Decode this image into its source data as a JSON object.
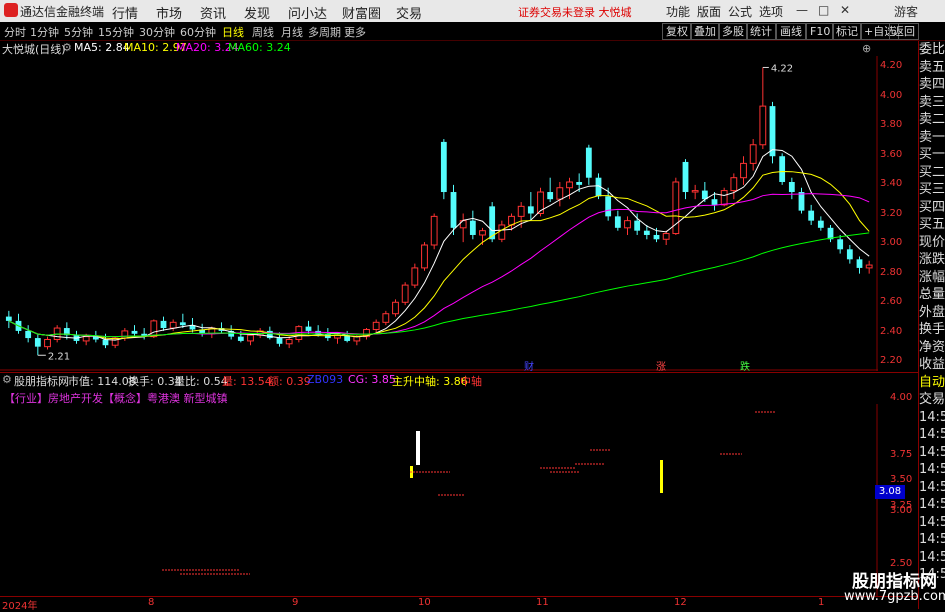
{
  "app": {
    "title": "通达信金融终端",
    "notice": "证券交易未登录 大悦城"
  },
  "menu": [
    "行情",
    "市场",
    "资讯",
    "发现",
    "问小达",
    "财富圈",
    "交易"
  ],
  "right_menu": [
    "功能",
    "版面",
    "公式",
    "选项"
  ],
  "window_buttons": {
    "guest": "游客",
    "min": "—",
    "max": "□",
    "close": "✕"
  },
  "periods": [
    "分时",
    "1分钟",
    "5分钟",
    "15分钟",
    "30分钟",
    "60分钟",
    "日线",
    "周线",
    "月线",
    "多周期",
    "更多"
  ],
  "toolbar_right": [
    "复权",
    "叠加",
    "多股",
    "统计",
    "画线",
    "F10",
    "标记",
    "+自选",
    "返回"
  ],
  "info": {
    "stock": "大悦城(日线)",
    "ma5": "MA5: 2.84",
    "ma10": "MA10: 2.97",
    "ma20": "MA20: 3.24",
    "ma60": "MA60: 3.24",
    "high_label": "4.22",
    "low_label": "2.21"
  },
  "price_axis": [
    "4.20",
    "4.00",
    "3.80",
    "3.60",
    "3.40",
    "3.20",
    "3.00",
    "2.80",
    "2.60",
    "2.40",
    "2.20"
  ],
  "events": [
    "财",
    "涨",
    "跌"
  ],
  "indicator": {
    "name": "股朋指标网",
    "market_cap": "市值: 114.08",
    "turnover": "换手: 0.34",
    "vol_ratio": "量比: 0.54",
    "vol": "量: 13.54",
    "pct": "额: 0.39",
    "zb": "ZB093",
    "cg": "CG: 3.85",
    "axis": "主升中轴: 3.86",
    "mid": "中轴"
  },
  "tags": "【行业】房地产开发【概念】粤港澳 新型城镇",
  "low_axis": [
    "4.00",
    "3.75",
    "3.50",
    "3.25",
    "3.00",
    "2.50"
  ],
  "low_axis_value": "3.08",
  "date_axis": [
    "2024年",
    "8",
    "9",
    "10",
    "11",
    "12",
    "1"
  ],
  "side_panel": [
    "委比",
    "卖五",
    "卖四",
    "卖三",
    "卖二",
    "卖一",
    "买一",
    "买二",
    "买三",
    "买四",
    "买五",
    "现价",
    "涨跌",
    "涨幅",
    "总量",
    "外盘",
    "换手",
    "净资",
    "收益",
    "自动",
    "交易",
    "14:56",
    "14:56",
    "14:56",
    "14:56",
    "14:56",
    "14:56",
    "14:56",
    "14:56",
    "14:56",
    "14:56"
  ],
  "watermark": {
    "line1": "股朋指标网",
    "line2": "www.7gpzb.com"
  },
  "colors": {
    "up": "#ff3333",
    "down": "#54fcfc",
    "ma5": "#ffffff",
    "ma10": "#ffff00",
    "ma20": "#ff00ff",
    "ma60": "#00ff00"
  },
  "chart_data": {
    "type": "candlestick",
    "ylim": [
      2.1,
      4.3
    ],
    "ohlc": [
      [
        2.48,
        2.52,
        2.4,
        2.45
      ],
      [
        2.45,
        2.5,
        2.36,
        2.38
      ],
      [
        2.38,
        2.42,
        2.3,
        2.33
      ],
      [
        2.33,
        2.36,
        2.21,
        2.27
      ],
      [
        2.27,
        2.34,
        2.25,
        2.32
      ],
      [
        2.32,
        2.42,
        2.3,
        2.4
      ],
      [
        2.4,
        2.44,
        2.32,
        2.35
      ],
      [
        2.35,
        2.38,
        2.29,
        2.31
      ],
      [
        2.31,
        2.36,
        2.28,
        2.34
      ],
      [
        2.34,
        2.38,
        2.3,
        2.32
      ],
      [
        2.32,
        2.36,
        2.26,
        2.28
      ],
      [
        2.28,
        2.34,
        2.26,
        2.33
      ],
      [
        2.33,
        2.4,
        2.31,
        2.38
      ],
      [
        2.38,
        2.42,
        2.34,
        2.36
      ],
      [
        2.36,
        2.4,
        2.32,
        2.34
      ],
      [
        2.34,
        2.46,
        2.33,
        2.45
      ],
      [
        2.45,
        2.48,
        2.38,
        2.4
      ],
      [
        2.4,
        2.46,
        2.38,
        2.44
      ],
      [
        2.44,
        2.5,
        2.4,
        2.42
      ],
      [
        2.42,
        2.47,
        2.37,
        2.39
      ],
      [
        2.39,
        2.43,
        2.34,
        2.36
      ],
      [
        2.36,
        2.41,
        2.33,
        2.4
      ],
      [
        2.4,
        2.44,
        2.36,
        2.38
      ],
      [
        2.38,
        2.42,
        2.32,
        2.34
      ],
      [
        2.34,
        2.38,
        2.3,
        2.31
      ],
      [
        2.31,
        2.36,
        2.28,
        2.35
      ],
      [
        2.35,
        2.4,
        2.33,
        2.38
      ],
      [
        2.38,
        2.41,
        2.32,
        2.33
      ],
      [
        2.33,
        2.37,
        2.27,
        2.29
      ],
      [
        2.29,
        2.34,
        2.26,
        2.32
      ],
      [
        2.32,
        2.42,
        2.3,
        2.41
      ],
      [
        2.41,
        2.45,
        2.36,
        2.38
      ],
      [
        2.38,
        2.42,
        2.34,
        2.36
      ],
      [
        2.36,
        2.4,
        2.31,
        2.33
      ],
      [
        2.33,
        2.37,
        2.29,
        2.35
      ],
      [
        2.35,
        2.38,
        2.3,
        2.31
      ],
      [
        2.31,
        2.35,
        2.28,
        2.34
      ],
      [
        2.34,
        2.4,
        2.32,
        2.39
      ],
      [
        2.39,
        2.46,
        2.37,
        2.44
      ],
      [
        2.44,
        2.52,
        2.42,
        2.5
      ],
      [
        2.5,
        2.6,
        2.48,
        2.58
      ],
      [
        2.58,
        2.72,
        2.56,
        2.7
      ],
      [
        2.7,
        2.85,
        2.68,
        2.82
      ],
      [
        2.82,
        3.0,
        2.8,
        2.98
      ],
      [
        2.98,
        3.2,
        2.95,
        3.18
      ],
      [
        3.7,
        3.72,
        3.3,
        3.35
      ],
      [
        3.35,
        3.4,
        3.05,
        3.1
      ],
      [
        3.1,
        3.2,
        3.0,
        3.15
      ],
      [
        3.15,
        3.22,
        3.02,
        3.05
      ],
      [
        3.05,
        3.1,
        2.98,
        3.08
      ],
      [
        3.25,
        3.28,
        3.0,
        3.02
      ],
      [
        3.02,
        3.15,
        3.0,
        3.12
      ],
      [
        3.12,
        3.2,
        3.08,
        3.18
      ],
      [
        3.18,
        3.28,
        3.1,
        3.25
      ],
      [
        3.25,
        3.35,
        3.15,
        3.2
      ],
      [
        3.2,
        3.38,
        3.18,
        3.35
      ],
      [
        3.35,
        3.45,
        3.28,
        3.3
      ],
      [
        3.3,
        3.42,
        3.25,
        3.38
      ],
      [
        3.38,
        3.45,
        3.3,
        3.42
      ],
      [
        3.42,
        3.48,
        3.35,
        3.4
      ],
      [
        3.66,
        3.68,
        3.4,
        3.45
      ],
      [
        3.45,
        3.48,
        3.3,
        3.32
      ],
      [
        3.32,
        3.38,
        3.15,
        3.18
      ],
      [
        3.18,
        3.22,
        3.08,
        3.1
      ],
      [
        3.1,
        3.18,
        3.05,
        3.15
      ],
      [
        3.15,
        3.2,
        3.05,
        3.08
      ],
      [
        3.08,
        3.12,
        3.02,
        3.05
      ],
      [
        3.05,
        3.1,
        3.0,
        3.02
      ],
      [
        3.02,
        3.08,
        2.98,
        3.06
      ],
      [
        3.06,
        3.45,
        3.05,
        3.42
      ],
      [
        3.56,
        3.58,
        3.3,
        3.35
      ],
      [
        3.35,
        3.4,
        3.3,
        3.36
      ],
      [
        3.36,
        3.42,
        3.28,
        3.3
      ],
      [
        3.3,
        3.35,
        3.22,
        3.26
      ],
      [
        3.26,
        3.38,
        3.25,
        3.36
      ],
      [
        3.36,
        3.48,
        3.3,
        3.45
      ],
      [
        3.45,
        3.6,
        3.4,
        3.55
      ],
      [
        3.55,
        3.72,
        3.5,
        3.68
      ],
      [
        3.68,
        4.22,
        3.65,
        3.95
      ],
      [
        3.95,
        3.98,
        3.55,
        3.6
      ],
      [
        3.6,
        3.62,
        3.4,
        3.42
      ],
      [
        3.42,
        3.45,
        3.3,
        3.35
      ],
      [
        3.35,
        3.38,
        3.2,
        3.22
      ],
      [
        3.22,
        3.26,
        3.12,
        3.15
      ],
      [
        3.15,
        3.18,
        3.08,
        3.1
      ],
      [
        3.1,
        3.12,
        3.0,
        3.02
      ],
      [
        3.02,
        3.05,
        2.92,
        2.95
      ],
      [
        2.95,
        2.98,
        2.85,
        2.88
      ],
      [
        2.88,
        2.9,
        2.78,
        2.82
      ],
      [
        2.82,
        2.87,
        2.78,
        2.84
      ]
    ]
  }
}
